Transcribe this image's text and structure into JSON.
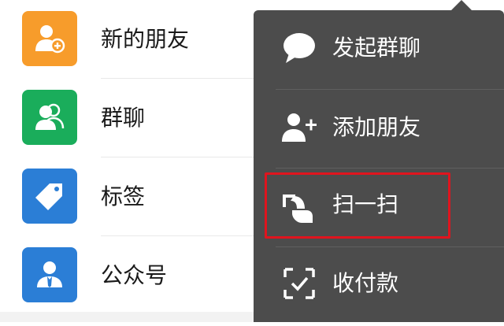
{
  "contacts": [
    {
      "label": "新的朋友",
      "icon": "add-friend-icon",
      "color": "#f79c2b"
    },
    {
      "label": "群聊",
      "icon": "group-chat-icon",
      "color": "#1aad5b"
    },
    {
      "label": "标签",
      "icon": "tag-icon",
      "color": "#2b7ed6"
    },
    {
      "label": "公众号",
      "icon": "official-account-icon",
      "color": "#2b7ed6"
    }
  ],
  "menu": {
    "items": [
      {
        "label": "发起群聊",
        "icon": "chat-bubble-icon"
      },
      {
        "label": "添加朋友",
        "icon": "add-person-icon"
      },
      {
        "label": "扫一扫",
        "icon": "scan-icon",
        "highlighted": true
      },
      {
        "label": "收付款",
        "icon": "payment-icon"
      }
    ],
    "background": "#4c4c4c",
    "highlight_color": "#e0141e"
  }
}
